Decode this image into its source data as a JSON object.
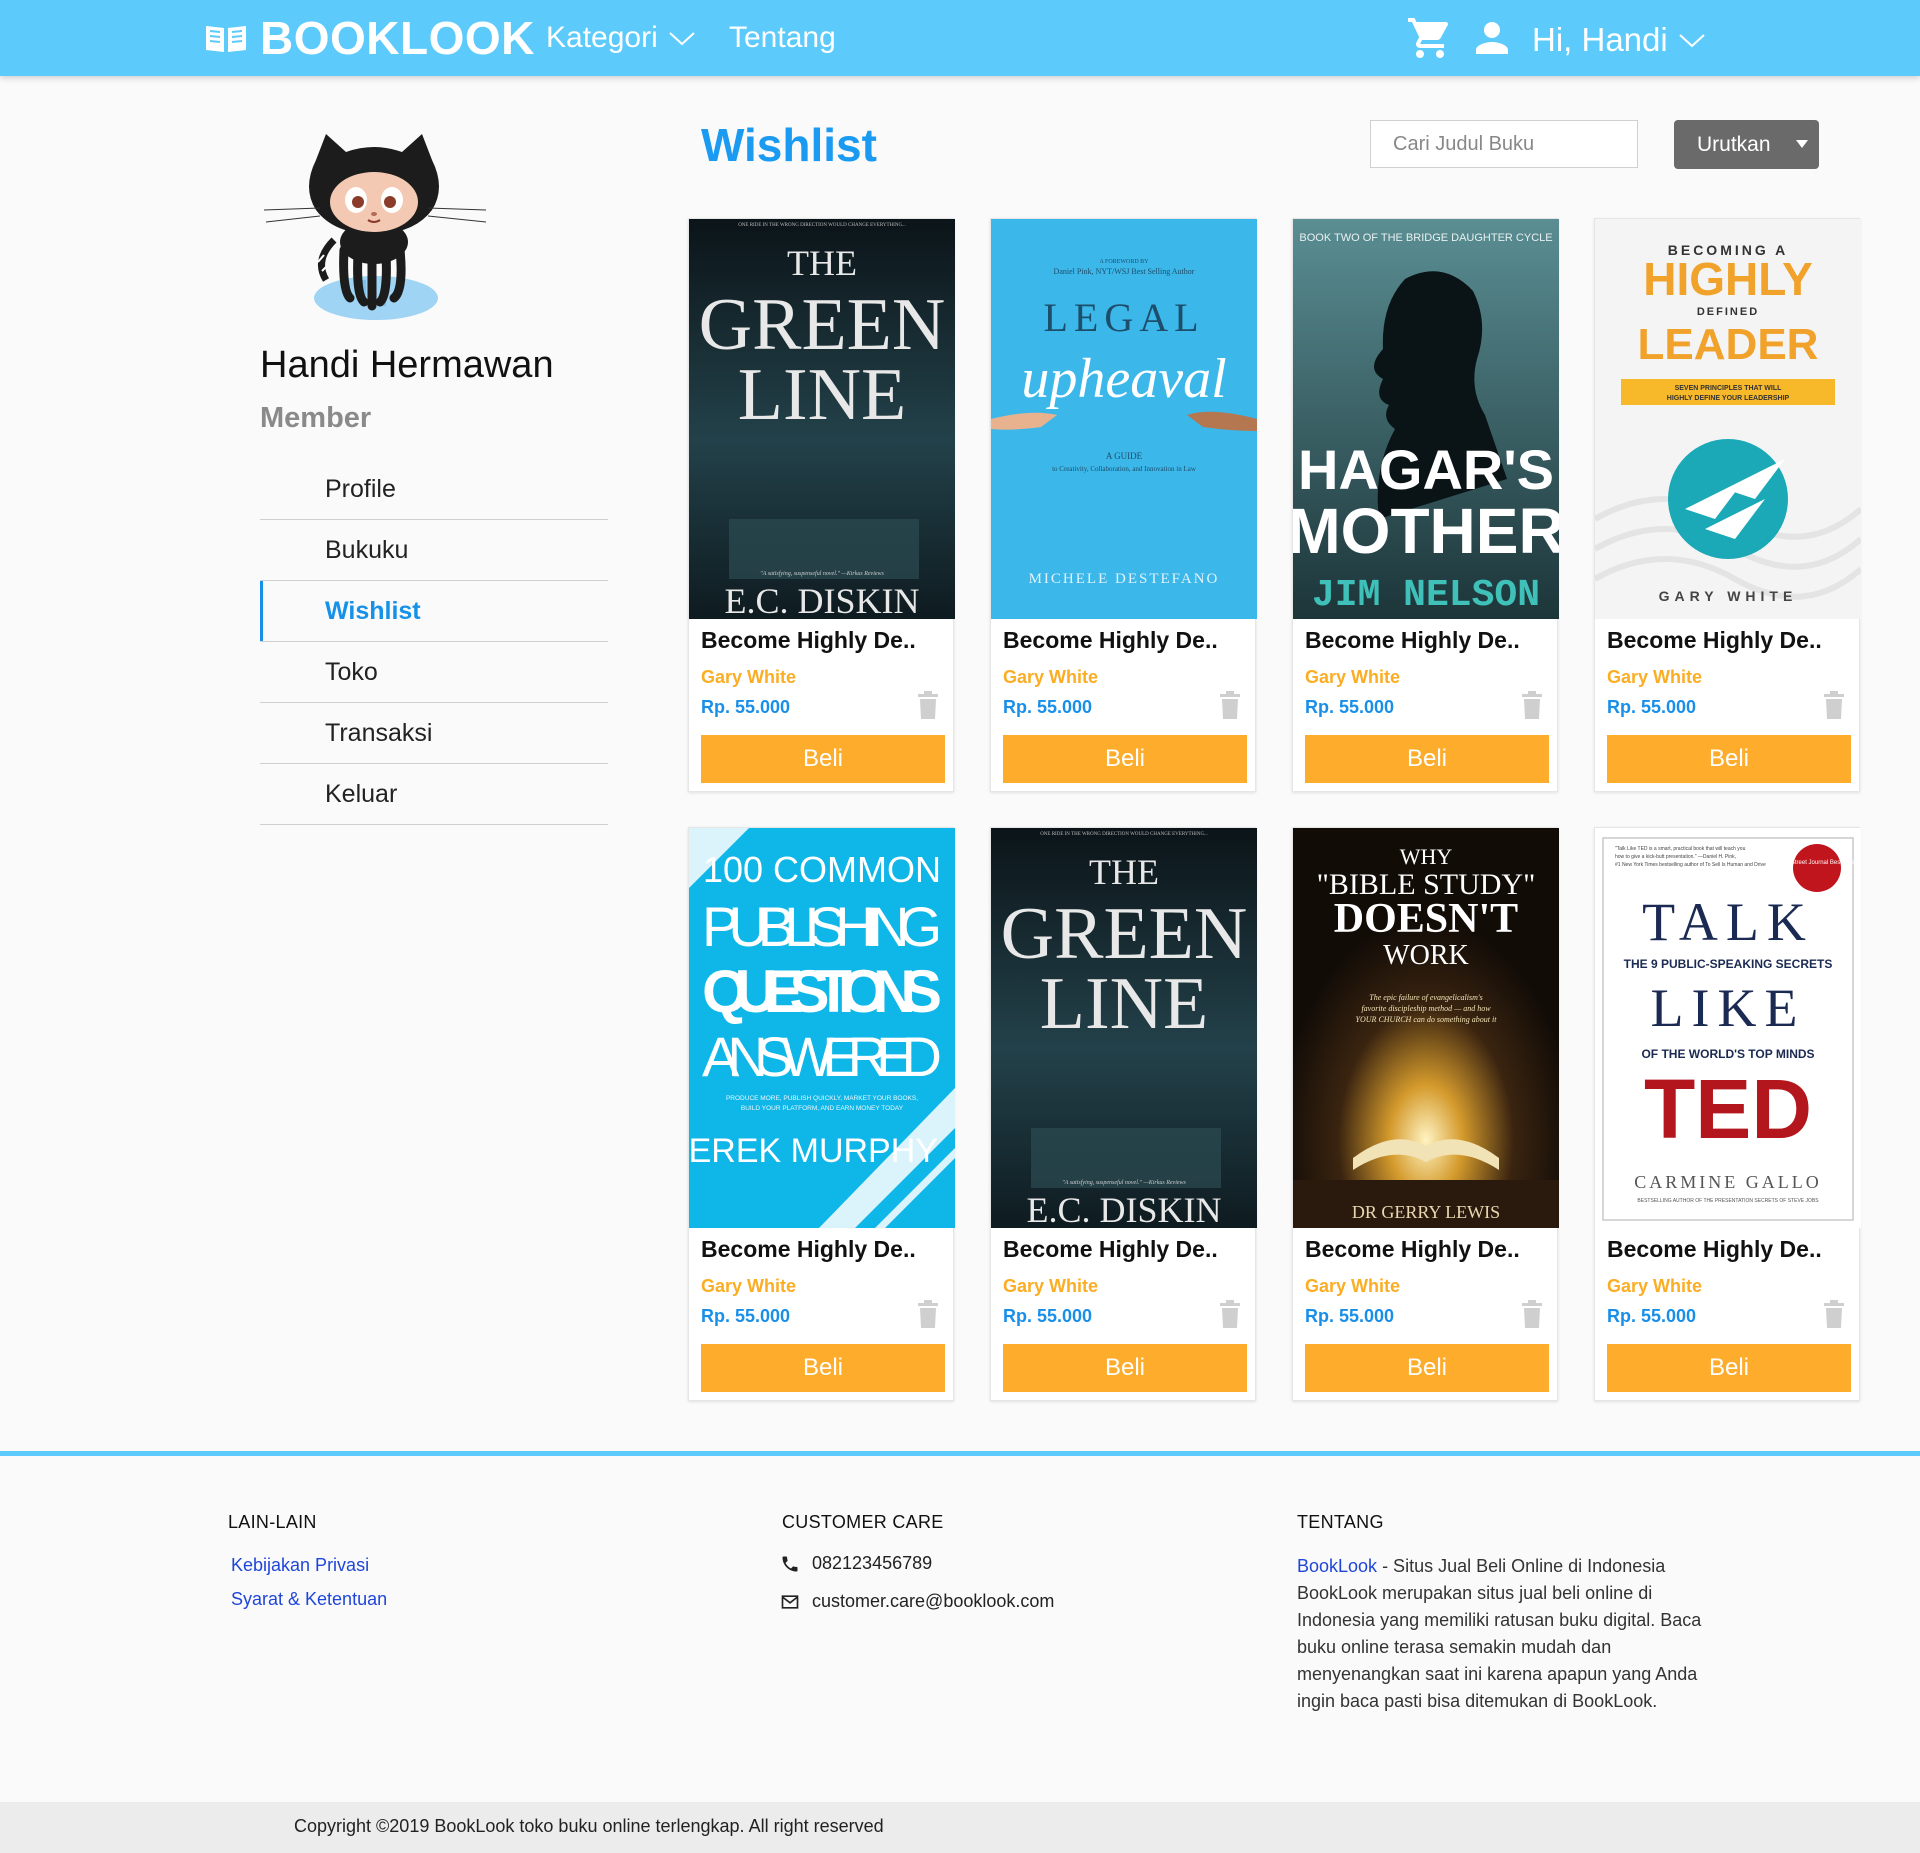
{
  "colors": {
    "navbar": "#5ccbfb",
    "accent_blue": "#1a9af0",
    "author_orange": "#fbad23",
    "buy_button": "#fdac2b",
    "price_blue": "#1a8fe8",
    "link_blue": "#1f46d8",
    "sort_button": "#6a6a6a"
  },
  "header": {
    "brand": "BOOKLOOK",
    "brand_icon": "open-book-icon",
    "nav": {
      "kategori": "Kategori",
      "tentang": "Tentang"
    },
    "cart_icon": "cart-icon",
    "user_icon": "user-icon",
    "greeting": "Hi, Handi"
  },
  "sidebar": {
    "avatar_icon": "octocat-avatar",
    "name": "Handi Hermawan",
    "role": "Member",
    "menu": [
      "Profile",
      "Bukuku",
      "Wishlist",
      "Toko",
      "Transaksi",
      "Keluar"
    ],
    "active": "Wishlist"
  },
  "main": {
    "title": "Wishlist",
    "search_placeholder": "Cari Judul Buku",
    "sort_label": "Urutkan",
    "buy_label": "Beli",
    "books": [
      {
        "title": "Become Highly De..",
        "author": "Gary White",
        "price": "Rp. 55.000",
        "cover": {
          "lines": [
            "ONE RIDE IN THE WRONG DIRECTION WOULD CHANGE EVERYTHING...",
            "THE",
            "GREEN",
            "LINE",
            "\"A satisfying, suspenseful novel.\" —Kirkus Reviews",
            "E.C. DISKIN"
          ]
        }
      },
      {
        "title": "Become Highly De..",
        "author": "Gary White",
        "price": "Rp. 55.000",
        "cover": {
          "lines": [
            "A FOREWORD BY",
            "Daniel Pink, NYT/WSJ Best Selling Author",
            "LEGAL",
            "upheaval",
            "A GUIDE",
            "to Creativity, Collaboration, and Innovation in Law",
            "MICHELE DESTEFANO"
          ]
        }
      },
      {
        "title": "Become Highly De..",
        "author": "Gary White",
        "price": "Rp. 55.000",
        "cover": {
          "lines": [
            "BOOK TWO OF THE BRIDGE DAUGHTER CYCLE",
            "HAGAR'S",
            "MOTHER",
            "JIM NELSON"
          ]
        }
      },
      {
        "title": "Become Highly De..",
        "author": "Gary White",
        "price": "Rp. 55.000",
        "cover": {
          "lines": [
            "BECOMING A",
            "HIGHLY",
            "DEFINED",
            "LEADER",
            "SEVEN PRINCIPLES THAT WILL",
            "HIGHLY DEFINE YOUR LEADERSHIP",
            "GARY WHITE"
          ]
        }
      },
      {
        "title": "Become Highly De..",
        "author": "Gary White",
        "price": "Rp. 55.000",
        "cover": {
          "lines": [
            "100 COMMON",
            "PUBLISHING",
            "QUESTIONS",
            "ANSWERED",
            "PRODUCE MORE, PUBLISH QUICKLY, MARKET YOUR BOOKS,",
            "BUILD YOUR PLATFORM, AND EARN MONEY TODAY",
            "DEREK MURPHY"
          ]
        }
      },
      {
        "title": "Become Highly De..",
        "author": "Gary White",
        "price": "Rp. 55.000",
        "cover": {
          "lines": [
            "ONE RIDE IN THE WRONG DIRECTION WOULD CHANGE EVERYTHING...",
            "THE",
            "GREEN",
            "LINE",
            "\"A satisfying, suspenseful novel.\" —Kirkus Reviews",
            "E.C. DISKIN"
          ]
        }
      },
      {
        "title": "Become Highly De..",
        "author": "Gary White",
        "price": "Rp. 55.000",
        "cover": {
          "lines": [
            "WHY",
            "\"BIBLE STUDY\"",
            "DOESN'T",
            "WORK",
            "The epic failure of evangelicalism's",
            "favorite discipleship method — and how",
            "YOUR CHURCH can do something about it",
            "DR GERRY LEWIS"
          ]
        }
      },
      {
        "title": "Become Highly De..",
        "author": "Gary White",
        "price": "Rp. 55.000",
        "cover": {
          "lines": [
            "\"Talk Like TED is a smart, practical book that will teach you",
            "how to give a kick-butt presentation.\" —Daniel H. Pink,",
            "#1 New York Times bestselling author of To Sell Is Human and Drive",
            "Wall Street Journal Bestseller",
            "TALK",
            "THE 9 PUBLIC-SPEAKING SECRETS",
            "LIKE",
            "OF THE WORLD'S TOP MINDS",
            "TED",
            "CARMINE GALLO",
            "BESTSELLING AUTHOR OF THE PRESENTATION SECRETS OF STEVE JOBS"
          ]
        }
      }
    ]
  },
  "footer": {
    "lain_lain": {
      "heading": "LAIN-LAIN",
      "links": [
        "Kebijakan Privasi",
        "Syarat & Ketentuan"
      ]
    },
    "customer_care": {
      "heading": "CUSTOMER CARE",
      "phone": "082123456789",
      "email": "customer.care@booklook.com",
      "phone_icon": "phone-icon",
      "email_icon": "mail-icon"
    },
    "tentang": {
      "heading": "TENTANG",
      "brand_link": "BookLook",
      "text": " - Situs Jual Beli Online di Indonesia BookLook merupakan situs jual beli online di Indonesia yang memiliki ratusan buku digital. Baca buku online terasa semakin mudah dan menyenangkan saat ini karena apapun yang Anda ingin baca pasti bisa ditemukan di BookLook."
    },
    "copyright": "Copyright ©2019 BookLook toko buku online terlengkap. All right reserved"
  }
}
